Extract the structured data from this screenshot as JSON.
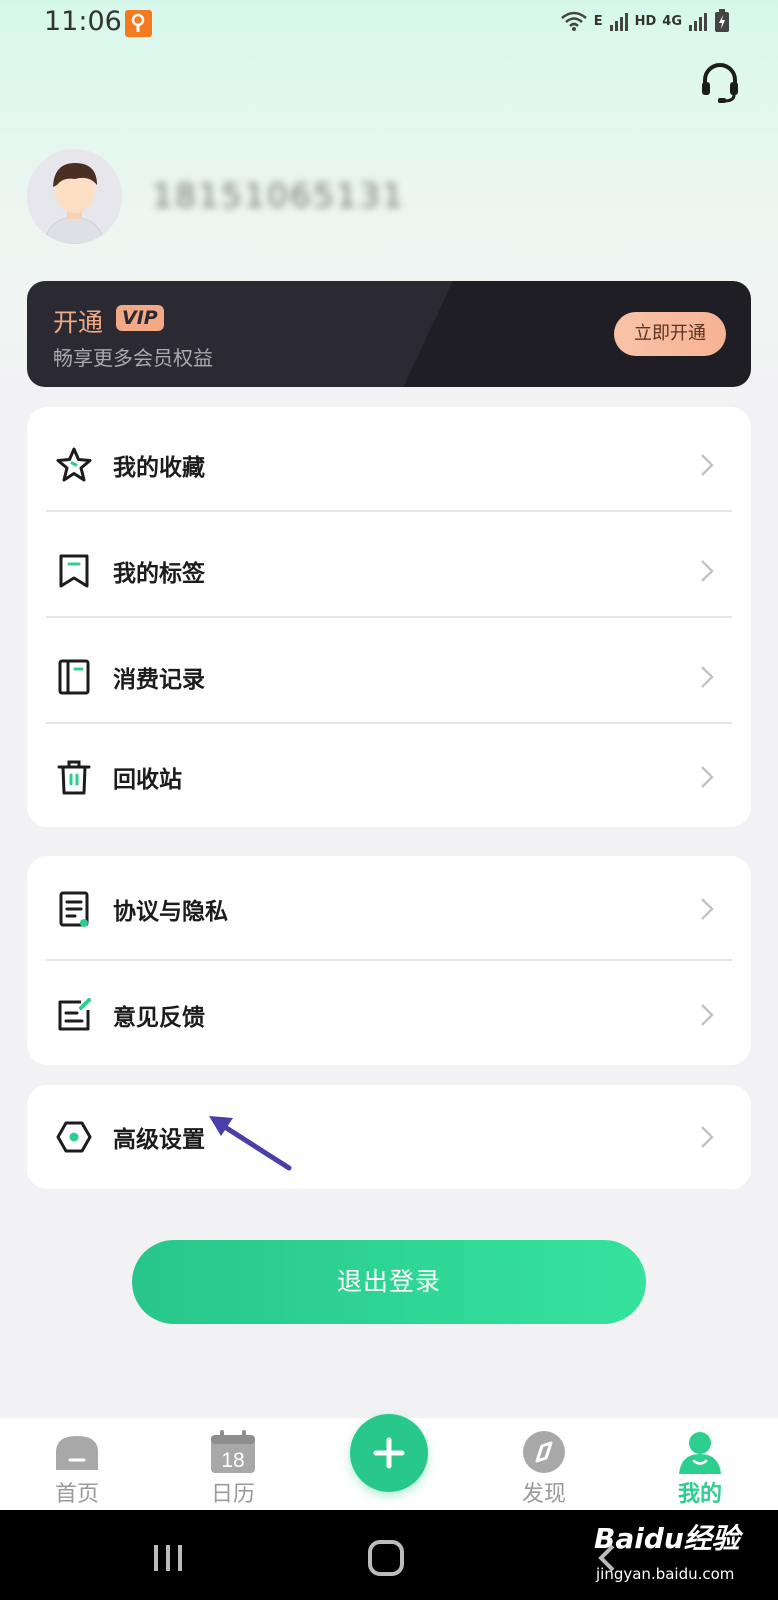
{
  "status_bar": {
    "time": "11:06",
    "network": "4G",
    "hd": "HD",
    "signal_e": "E"
  },
  "profile": {
    "username": "18151065131"
  },
  "vip": {
    "title": "开通",
    "badge": "VIP",
    "subtitle": "畅享更多会员权益",
    "button": "立即开通"
  },
  "menu_group_1": [
    {
      "label": "我的收藏",
      "icon": "star-icon"
    },
    {
      "label": "我的标签",
      "icon": "bookmark-tag-icon"
    },
    {
      "label": "消费记录",
      "icon": "notebook-icon"
    },
    {
      "label": "回收站",
      "icon": "trash-icon"
    }
  ],
  "menu_group_2": [
    {
      "label": "协议与隐私",
      "icon": "document-icon"
    },
    {
      "label": "意见反馈",
      "icon": "feedback-edit-icon"
    }
  ],
  "menu_group_3": [
    {
      "label": "高级设置",
      "icon": "hexagon-settings-icon"
    }
  ],
  "logout": {
    "label": "退出登录"
  },
  "tabbar": {
    "home": "首页",
    "calendar": "日历",
    "calendar_day": "18",
    "discover": "发现",
    "mine": "我的"
  },
  "watermark": {
    "brand": "Baidu经验",
    "url": "jingyan.baidu.com"
  },
  "colors": {
    "accent": "#2ccf8e",
    "vip_bg": "#2b2a33",
    "vip_gold": "#f3a886",
    "annotation_arrow": "#4a3fa8"
  }
}
